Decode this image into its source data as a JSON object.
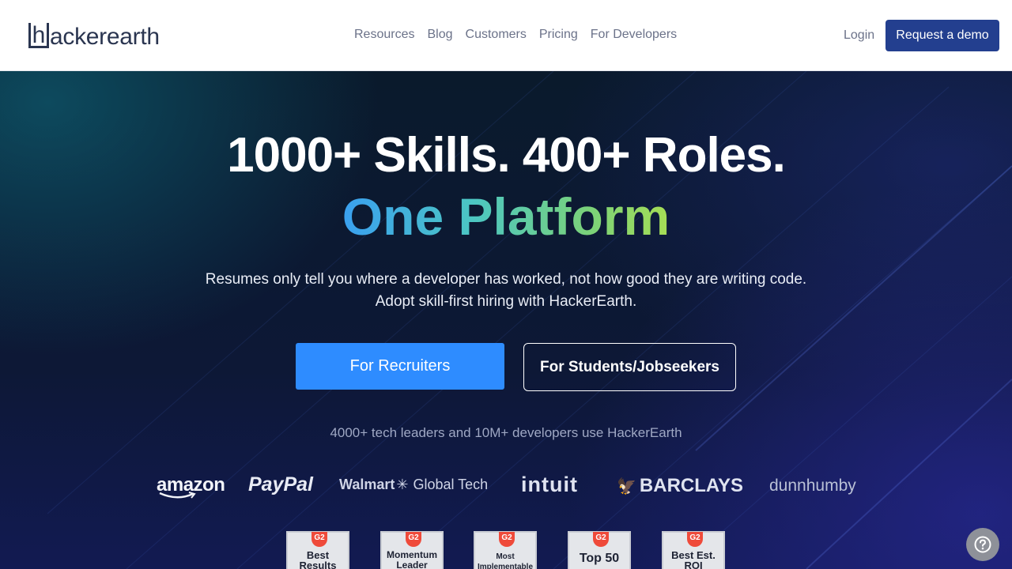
{
  "header": {
    "logo_initial": "h",
    "logo_rest": "ackerearth",
    "nav": [
      "Resources",
      "Blog",
      "Customers",
      "Pricing",
      "For Developers"
    ],
    "login_label": "Login",
    "demo_label": "Request a demo"
  },
  "hero": {
    "title_line1": "1000+ Skills. 400+ Roles.",
    "title_line2": "One Platform",
    "subtitle_line1": "Resumes only tell you where a developer has worked, not how good they are writing code.",
    "subtitle_line2": "Adopt skill-first hiring with HackerEarth.",
    "recruiters_label": "For Recruiters",
    "students_label": "For Students/Jobseekers",
    "tagline": "4000+ tech leaders and 10M+ developers use HackerEarth"
  },
  "client_logos": {
    "amazon": "amazon",
    "paypal": "PayPal",
    "walmart": "Walmart",
    "walmart_suffix": "Global Tech",
    "intuit": "intuit",
    "barclays": "BARCLAYS",
    "dunnhumby": "dunnhumby"
  },
  "badges": [
    {
      "mark": "G2",
      "text": "Best Results"
    },
    {
      "mark": "G2",
      "text": "Momentum Leader"
    },
    {
      "mark": "G2",
      "text": "Most Implementable"
    },
    {
      "mark": "G2",
      "text": "Top 50"
    },
    {
      "mark": "G2",
      "text": "Best Est. ROI"
    }
  ],
  "icons": {
    "help": "question-circle-icon",
    "walmart_spark": "spark-icon",
    "barclays_eagle": "eagle-icon"
  },
  "colors": {
    "brand_dark": "#2a3550",
    "demo_button": "#233f8f",
    "recruiters_button": "#2e8cff",
    "gradient_start": "#3aa0f0",
    "gradient_end": "#a6dd55"
  }
}
